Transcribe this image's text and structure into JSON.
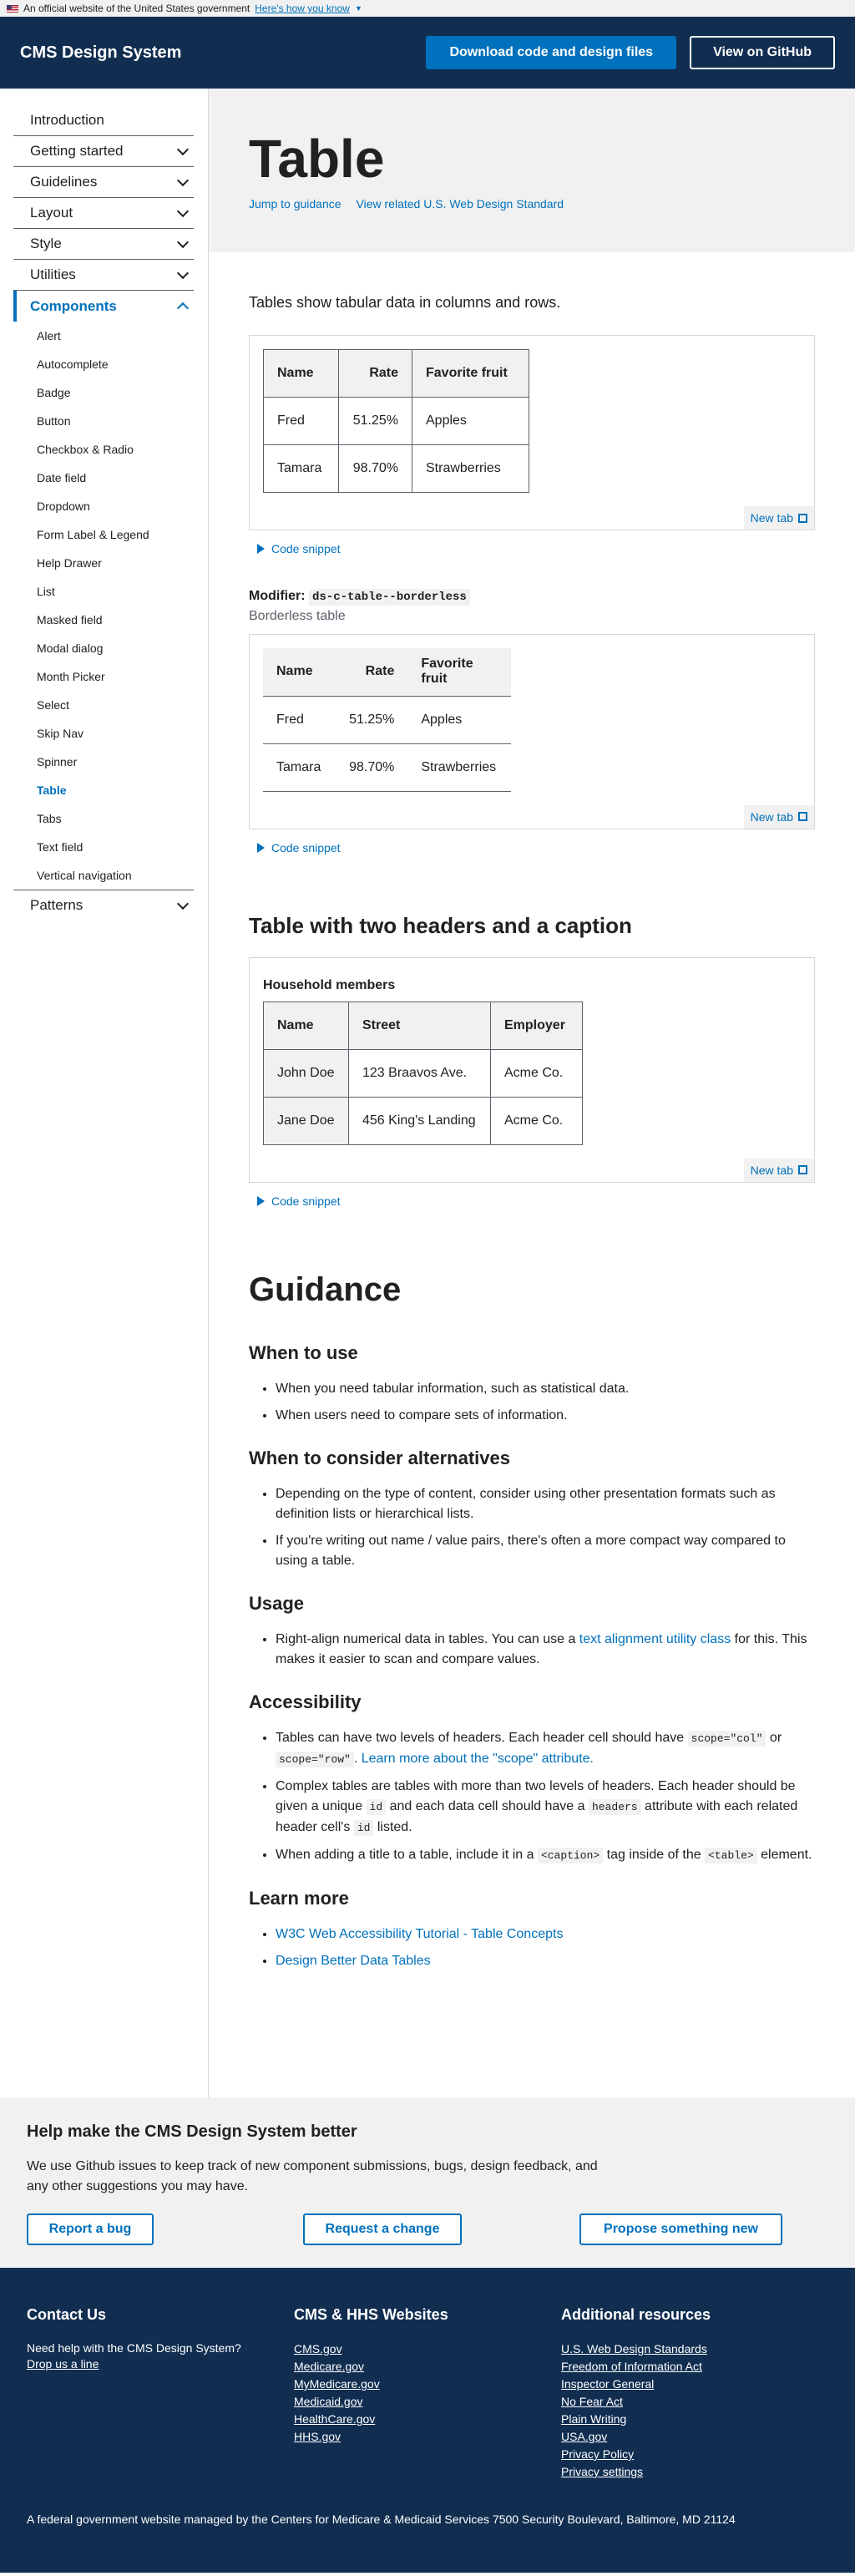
{
  "banner": {
    "text": "An official website of the United States government",
    "link": "Here's how you know"
  },
  "header": {
    "title": "CMS Design System",
    "download_label": "Download code and design files",
    "github_label": "View on GitHub"
  },
  "nav": {
    "top": [
      {
        "label": "Introduction"
      },
      {
        "label": "Getting started"
      },
      {
        "label": "Guidelines"
      },
      {
        "label": "Layout"
      },
      {
        "label": "Style"
      },
      {
        "label": "Utilities"
      }
    ],
    "components_label": "Components",
    "components": [
      "Alert",
      "Autocomplete",
      "Badge",
      "Button",
      "Checkbox & Radio",
      "Date field",
      "Dropdown",
      "Form Label & Legend",
      "Help Drawer",
      "List",
      "Masked field",
      "Modal dialog",
      "Month Picker",
      "Select",
      "Skip Nav",
      "Spinner",
      "Table",
      "Tabs",
      "Text field",
      "Vertical navigation"
    ],
    "current": "Table",
    "patterns_label": "Patterns"
  },
  "hero": {
    "title": "Table",
    "jump_link": "Jump to guidance",
    "related_link": "View related U.S. Web Design Standard"
  },
  "intro": "Tables show tabular data in columns and rows.",
  "table1": {
    "headers": [
      "Name",
      "Rate",
      "Favorite fruit"
    ],
    "rows": [
      [
        "Fred",
        "51.25%",
        "Apples"
      ],
      [
        "Tamara",
        "98.70%",
        "Strawberries"
      ]
    ]
  },
  "new_tab": "New tab",
  "code_snippet": "Code snippet",
  "modifier": {
    "label": "Modifier:",
    "class": "ds-c-table--borderless",
    "desc": "Borderless table"
  },
  "table2": {
    "headers": [
      "Name",
      "Rate",
      "Favorite fruit"
    ],
    "rows": [
      [
        "Fred",
        "51.25%",
        "Apples"
      ],
      [
        "Tamara",
        "98.70%",
        "Strawberries"
      ]
    ]
  },
  "section3": {
    "title": "Table with two headers and a caption"
  },
  "table3": {
    "caption": "Household members",
    "headers": [
      "Name",
      "Street",
      "Employer"
    ],
    "rows": [
      [
        "John Doe",
        "123 Braavos Ave.",
        "Acme Co."
      ],
      [
        "Jane Doe",
        "456 King's Landing",
        "Acme Co."
      ]
    ]
  },
  "guidance": {
    "title": "Guidance",
    "when_title": "When to use",
    "when": [
      "When you need tabular information, such as statistical data.",
      "When users need to compare sets of information."
    ],
    "alt_title": "When to consider alternatives",
    "alt": [
      "Depending on the type of content, consider using other presentation formats such as definition lists or hierarchical lists.",
      "If you're writing out name / value pairs, there's often a more compact way compared to using a table."
    ],
    "usage_title": "Usage",
    "usage_pre": "Right-align numerical data in tables. You can use a ",
    "usage_link": "text alignment utility class",
    "usage_post": " for this. This makes it easier to scan and compare values.",
    "a11y_title": "Accessibility",
    "a11y1_pre": "Tables can have two levels of headers. Each header cell should have ",
    "a11y1_code1": "scope=\"col\"",
    "a11y1_or": " or ",
    "a11y1_code2": "scope=\"row\"",
    "a11y1_dot": ". ",
    "a11y1_link": "Learn more about the \"scope\" attribute.",
    "a11y2_pre": "Complex tables are tables with more than two levels of headers. Each header should be given a unique ",
    "a11y2_code1": "id",
    "a11y2_mid": " and each data cell should have a ",
    "a11y2_code2": "headers",
    "a11y2_mid2": " attribute with each related header cell's ",
    "a11y2_code3": "id",
    "a11y2_post": " listed.",
    "a11y3_pre": "When adding a title to a table, include it in a ",
    "a11y3_code1": "<caption>",
    "a11y3_mid": " tag inside of the ",
    "a11y3_code2": "<table>",
    "a11y3_post": " element.",
    "learn_title": "Learn more",
    "learn": [
      "W3C Web Accessibility Tutorial - Table Concepts",
      "Design Better Data Tables"
    ]
  },
  "feedback": {
    "title": "Help make the CMS Design System better",
    "text": "We use Github issues to keep track of new component submissions, bugs, design feedback, and any other suggestions you may have.",
    "buttons": [
      "Report a bug",
      "Request a change",
      "Propose something new"
    ]
  },
  "footer": {
    "contact_title": "Contact Us",
    "contact_text": "Need help with the CMS Design System?",
    "contact_link": "Drop us a line",
    "cms_title": "CMS & HHS Websites",
    "cms_links": [
      "CMS.gov",
      "Medicare.gov",
      "MyMedicare.gov",
      "Medicaid.gov",
      "HealthCare.gov",
      "HHS.gov"
    ],
    "res_title": "Additional resources",
    "res_links": [
      "U.S. Web Design Standards",
      "Freedom of Information Act",
      "Inspector General",
      "No Fear Act",
      "Plain Writing",
      "USA.gov",
      "Privacy Policy",
      "Privacy settings"
    ],
    "bottom": "A federal government website managed by the Centers for Medicare & Medicaid Services 7500 Security Boulevard, Baltimore, MD 21124"
  }
}
